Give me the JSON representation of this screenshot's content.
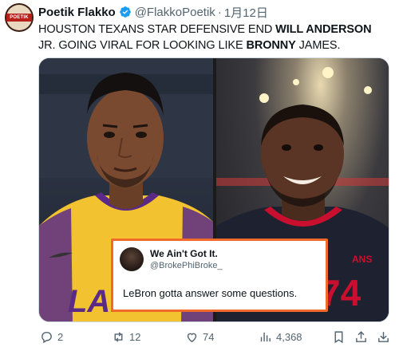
{
  "tweet": {
    "author": {
      "name": "Poetik Flakko",
      "handle": "@FlakkoPoetik",
      "separator": "·",
      "date": "1月12日",
      "avatar_text": "POETIK"
    },
    "text_parts": [
      {
        "text": "HOUSTON TEXANS STAR DEFENSIVE END ",
        "bold": false
      },
      {
        "text": "WILL ANDERSON",
        "bold": true
      },
      {
        "text": " JR. GOING VIRAL FOR LOOKING LIKE ",
        "bold": false
      },
      {
        "text": "BRONNY",
        "bold": true
      },
      {
        "text": " JAMES.",
        "bold": false
      }
    ],
    "quote": {
      "name": "We Ain't Got It.",
      "handle": "@BrokePhiBroke_",
      "text": "LeBron gotta answer some questions."
    },
    "stats": {
      "replies": "2",
      "reposts": "12",
      "likes": "74",
      "views": "4,368"
    },
    "icons": [
      "reply-icon",
      "repost-icon",
      "like-icon",
      "views-icon",
      "bookmark-icon",
      "share-icon",
      "download-icon"
    ],
    "colors": {
      "verified": "#1d9bf0",
      "quote_border": "#f26a2a",
      "secondary_text": "#536471"
    }
  }
}
